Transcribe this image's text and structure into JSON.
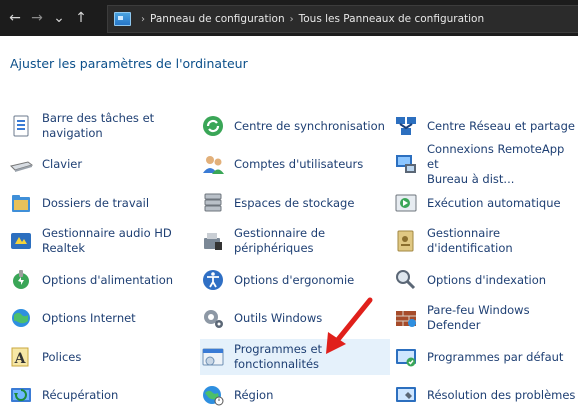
{
  "window": {
    "breadcrumb": [
      "Panneau de configuration",
      "Tous les Panneaux de configuration"
    ],
    "heading": "Ajuster les paramètres de l'ordinateur"
  },
  "nav": {
    "back": "←",
    "forward": "→",
    "recent": "⌄",
    "up": "↑",
    "separator": "›"
  },
  "items": [
    {
      "label": "Barre des tâches et\nnavigation",
      "icon": "taskbar-icon"
    },
    {
      "label": "Clavier",
      "icon": "keyboard-icon"
    },
    {
      "label": "Dossiers de travail",
      "icon": "work-folders-icon"
    },
    {
      "label": "Gestionnaire audio HD\nRealtek",
      "icon": "realtek-audio-icon"
    },
    {
      "label": "Options d'alimentation",
      "icon": "power-options-icon"
    },
    {
      "label": "Options Internet",
      "icon": "internet-options-icon"
    },
    {
      "label": "Polices",
      "icon": "fonts-icon"
    },
    {
      "label": "Récupération",
      "icon": "recovery-icon"
    },
    {
      "label": "Centre de synchronisation",
      "icon": "sync-center-icon"
    },
    {
      "label": "Comptes d'utilisateurs",
      "icon": "user-accounts-icon"
    },
    {
      "label": "Espaces de stockage",
      "icon": "storage-spaces-icon"
    },
    {
      "label": "Gestionnaire de\npériphériques",
      "icon": "device-manager-icon"
    },
    {
      "label": "Options d'ergonomie",
      "icon": "ease-of-access-icon"
    },
    {
      "label": "Outils Windows",
      "icon": "windows-tools-icon"
    },
    {
      "label": "Programmes et\nfonctionnalités",
      "icon": "programs-features-icon"
    },
    {
      "label": "Région",
      "icon": "region-icon"
    },
    {
      "label": "Centre Réseau et partage",
      "icon": "network-center-icon"
    },
    {
      "label": "Connexions RemoteApp et\nBureau à dist...",
      "icon": "remoteapp-icon"
    },
    {
      "label": "Exécution automatique",
      "icon": "autoplay-icon"
    },
    {
      "label": "Gestionnaire\nd'identification",
      "icon": "credential-manager-icon"
    },
    {
      "label": "Options d'indexation",
      "icon": "indexing-options-icon"
    },
    {
      "label": "Pare-feu Windows\nDefender",
      "icon": "firewall-icon"
    },
    {
      "label": "Programmes par défaut",
      "icon": "default-programs-icon"
    },
    {
      "label": "Résolution des problèmes",
      "icon": "troubleshooting-icon"
    }
  ],
  "colors": {
    "link": "#1e3f73",
    "heading": "#0b4f8a",
    "highlight": "#e5f1fb",
    "arrow": "#e0201b"
  }
}
